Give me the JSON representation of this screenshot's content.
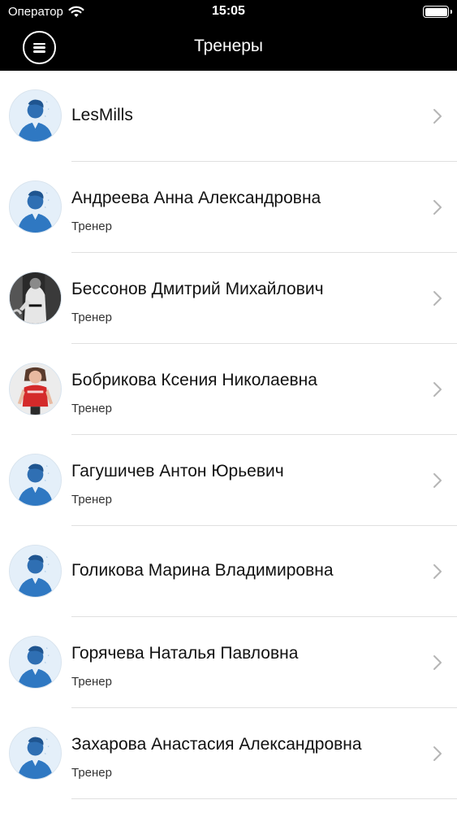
{
  "status_bar": {
    "carrier": "Оператор",
    "time": "15:05"
  },
  "header": {
    "title": "Тренеры"
  },
  "trainers": [
    {
      "name": "LesMills",
      "role": "",
      "avatar": "default-user-icon"
    },
    {
      "name": "Андреева Анна Александровна",
      "role": "Тренер",
      "avatar": "default-user-icon"
    },
    {
      "name": "Бессонов Дмитрий Михайлович",
      "role": "Тренер",
      "avatar": "photo-martial-arts"
    },
    {
      "name": "Бобрикова Ксения Николаевна",
      "role": "Тренер",
      "avatar": "photo-woman-red-shirt"
    },
    {
      "name": "Гагушичев Антон Юрьевич",
      "role": "Тренер",
      "avatar": "default-user-icon"
    },
    {
      "name": "Голикова Марина Владимировна",
      "role": "",
      "avatar": "default-user-icon"
    },
    {
      "name": "Горячева Наталья Павловна",
      "role": "Тренер",
      "avatar": "default-user-icon"
    },
    {
      "name": "Захарова Анастасия Александровна",
      "role": "Тренер",
      "avatar": "default-user-icon"
    }
  ]
}
